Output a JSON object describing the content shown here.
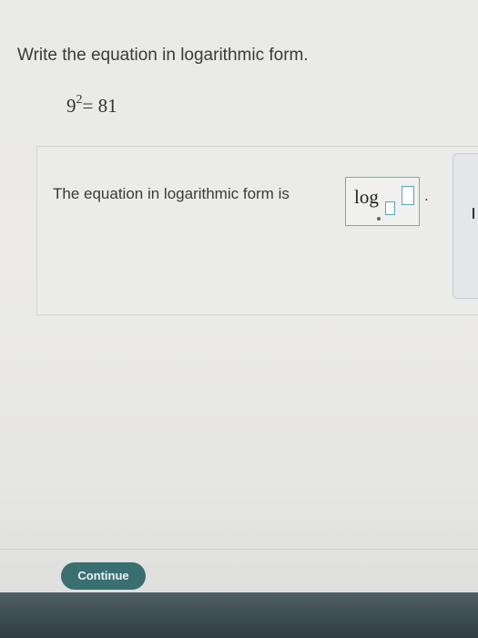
{
  "question": {
    "prompt": "Write the equation in logarithmic form.",
    "equation": {
      "base": "9",
      "exponent": "2",
      "rhs": "= 81"
    }
  },
  "answer": {
    "label": "The equation in logarithmic form is",
    "log_word": "log",
    "period": "."
  },
  "footer": {
    "continue_label": "Continue"
  },
  "colors": {
    "accent": "#3a6f72",
    "input_border": "#5aa3bf"
  }
}
